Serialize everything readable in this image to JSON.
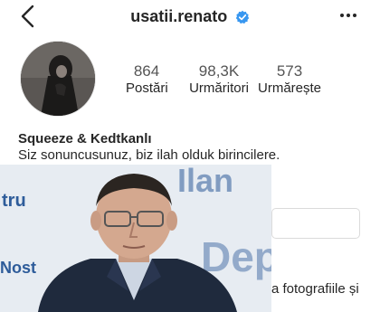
{
  "header": {
    "username": "usatii.renato",
    "back_icon": "chevron-left-icon",
    "verified_icon": "verified-badge-icon",
    "more_icon": "more-horizontal-icon"
  },
  "stats": [
    {
      "value": "864",
      "label": "Postări"
    },
    {
      "value": "98,3K",
      "label": "Urmăritori"
    },
    {
      "value": "573",
      "label": "Urmărește"
    }
  ],
  "bio": {
    "name": "Squeeze & Kedtkanlı",
    "text": "Siz sonuncusunuz, biz ilah olduk birincilere."
  },
  "background": {
    "partial_text": "a fotografiile și"
  },
  "overlay_photo": {
    "banner_fragments": [
      "tru",
      "Nost",
      "Ilan",
      "Dept"
    ]
  },
  "colors": {
    "verified_blue": "#3897f0",
    "text_primary": "#262626",
    "text_stat_value": "#555555",
    "banner_blue": "#2e5c9a"
  }
}
